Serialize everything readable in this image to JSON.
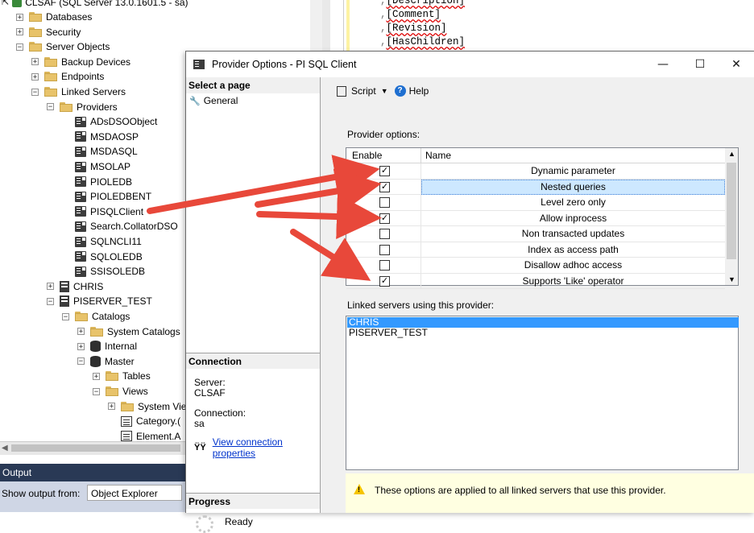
{
  "tree": {
    "root_label": "CLSAF (SQL Server 13.0.1601.5 - sa)",
    "items": [
      {
        "label": "Databases",
        "exp": "+"
      },
      {
        "label": "Security",
        "exp": "+"
      },
      {
        "label": "Server Objects",
        "exp": "−"
      },
      {
        "label": "Backup Devices",
        "exp": "+"
      },
      {
        "label": "Endpoints",
        "exp": "+"
      },
      {
        "label": "Linked Servers",
        "exp": "−"
      },
      {
        "label": "Providers",
        "exp": "−"
      },
      {
        "label": "ADsDSOObject"
      },
      {
        "label": "MSDAOSP"
      },
      {
        "label": "MSDASQL"
      },
      {
        "label": "MSOLAP"
      },
      {
        "label": "PIOLEDB"
      },
      {
        "label": "PIOLEDBENT"
      },
      {
        "label": "PISQLClient"
      },
      {
        "label": "Search.CollatorDSO"
      },
      {
        "label": "SQLNCLI11"
      },
      {
        "label": "SQLOLEDB"
      },
      {
        "label": "SSISOLEDB"
      },
      {
        "label": "CHRIS",
        "exp": "+"
      },
      {
        "label": "PISERVER_TEST",
        "exp": "−"
      },
      {
        "label": "Catalogs",
        "exp": "−"
      },
      {
        "label": "System Catalogs",
        "exp": "+"
      },
      {
        "label": "Internal",
        "exp": "+"
      },
      {
        "label": "Master",
        "exp": "−"
      },
      {
        "label": "Tables",
        "exp": "+"
      },
      {
        "label": "Views",
        "exp": "−"
      },
      {
        "label": "System Vie",
        "exp": "+"
      },
      {
        "label": "Category.("
      },
      {
        "label": "Element.A"
      }
    ]
  },
  "editor": {
    "lines": [
      {
        "comma": ",",
        "text": "[Description]"
      },
      {
        "comma": ",",
        "text": "[Comment]"
      },
      {
        "comma": ",",
        "text": "[Revision]"
      },
      {
        "comma": ",",
        "text": "[HasChildren]"
      }
    ]
  },
  "output": {
    "title": "Output",
    "show_from_label": "Show output from:",
    "show_from_value": "Object Explorer"
  },
  "dialog": {
    "title": "Provider Options - PI SQL Client",
    "minimize": "—",
    "maximize": "☐",
    "close": "✕",
    "select_page": "Select a page",
    "pages": [
      "General"
    ],
    "toolbar": {
      "script": "Script",
      "help": "Help"
    },
    "provider_options_label": "Provider options:",
    "columns": {
      "enable": "Enable",
      "name": "Name"
    },
    "options": [
      {
        "name": "Dynamic parameter",
        "checked": true
      },
      {
        "name": "Nested queries",
        "checked": true
      },
      {
        "name": "Level zero only",
        "checked": false
      },
      {
        "name": "Allow inprocess",
        "checked": true
      },
      {
        "name": "Non transacted updates",
        "checked": false
      },
      {
        "name": "Index as access path",
        "checked": false
      },
      {
        "name": "Disallow adhoc access",
        "checked": false
      },
      {
        "name": "Supports 'Like' operator",
        "checked": true
      }
    ],
    "linked_label": "Linked servers using this provider:",
    "linked_servers": [
      "CHRIS",
      "PISERVER_TEST"
    ],
    "note": "These options are applied to all linked servers that use this provider.",
    "connection": {
      "header": "Connection",
      "server_label": "Server:",
      "server_value": "CLSAF",
      "connection_label": "Connection:",
      "connection_value": "sa",
      "link": "View connection properties"
    },
    "progress": {
      "header": "Progress",
      "status": "Ready"
    }
  },
  "colors": {
    "arrow": "#e8483a",
    "selection": "#3399ff",
    "output_header": "#293955"
  }
}
